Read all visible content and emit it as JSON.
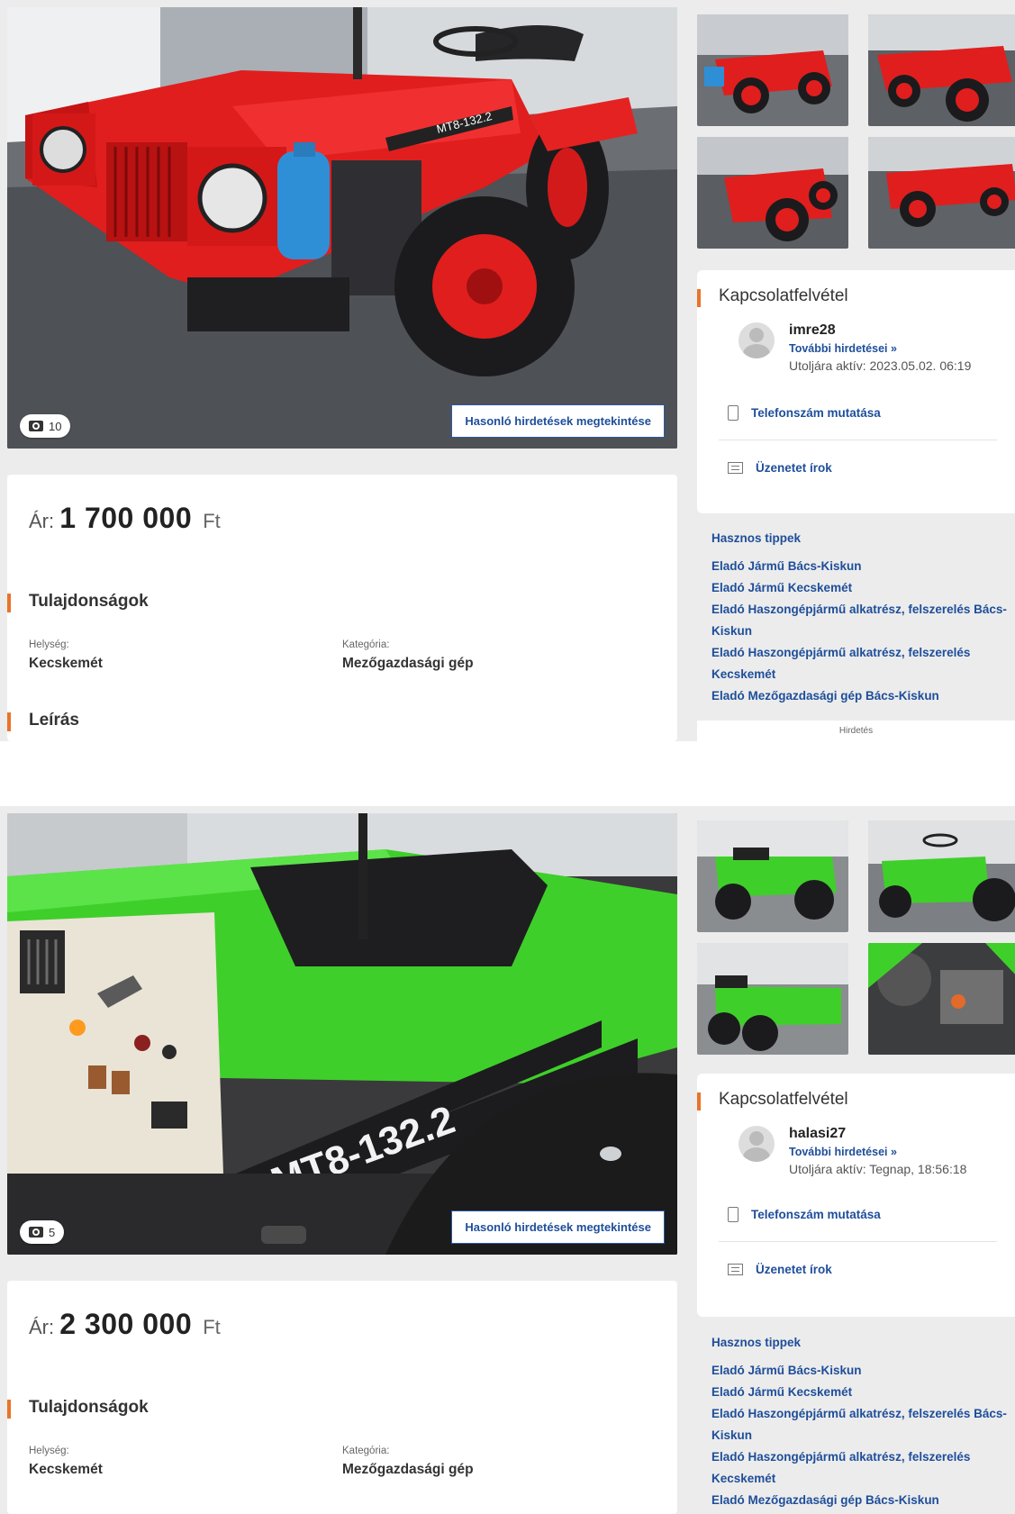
{
  "listings": [
    {
      "photo_count": "10",
      "similar_label": "Hasonló hirdetések megtekintése",
      "price_prefix": "Ár:",
      "price_value": "1 700 000",
      "price_currency": "Ft",
      "properties_title": "Tulajdonságok",
      "location_label": "Helység:",
      "location_value": "Kecskemét",
      "category_label": "Kategória:",
      "category_value": "Mezőgazdasági gép",
      "description_title": "Leírás",
      "contact_title": "Kapcsolatfelvétel",
      "username": "imre28",
      "more_ads": "További hirdetései »",
      "last_active": "Utoljára aktív: 2023.05.02. 06:19",
      "phone_label": "Telefonszám mutatása",
      "message_label": "Üzenetet írok",
      "tips_title": "Hasznos tippek",
      "tips": [
        "Eladó Jármű Bács-Kiskun",
        "Eladó Jármű Kecskemét",
        "Eladó Haszongépjármű alkatrész, felszerelés Bács-Kiskun",
        "Eladó Haszongépjármű alkatrész, felszerelés Kecskemét",
        "Eladó Mezőgazdasági gép Bács-Kiskun"
      ],
      "ad_label": "Hirdetés",
      "tractor_model": "MT8-132.2",
      "tractor_color": "#e01e1e"
    },
    {
      "photo_count": "5",
      "similar_label": "Hasonló hirdetések megtekintése",
      "price_prefix": "Ár:",
      "price_value": "2 300 000",
      "price_currency": "Ft",
      "properties_title": "Tulajdonságok",
      "location_label": "Helység:",
      "location_value": "Kecskemét",
      "category_label": "Kategória:",
      "category_value": "Mezőgazdasági gép",
      "contact_title": "Kapcsolatfelvétel",
      "username": "halasi27",
      "more_ads": "További hirdetései »",
      "last_active": "Utoljára aktív: Tegnap, 18:56:18",
      "phone_label": "Telefonszám mutatása",
      "message_label": "Üzenetet írok",
      "tips_title": "Hasznos tippek",
      "tips": [
        "Eladó Jármű Bács-Kiskun",
        "Eladó Jármű Kecskemét",
        "Eladó Haszongépjármű alkatrész, felszerelés Bács-Kiskun",
        "Eladó Haszongépjármű alkatrész, felszerelés Kecskemét",
        "Eladó Mezőgazdasági gép Bács-Kiskun"
      ],
      "tractor_model": "MT8-132.2",
      "tractor_color": "#3fcf2a"
    }
  ],
  "colors": {
    "accent": "#e8742a",
    "link": "#1e4e9a"
  }
}
